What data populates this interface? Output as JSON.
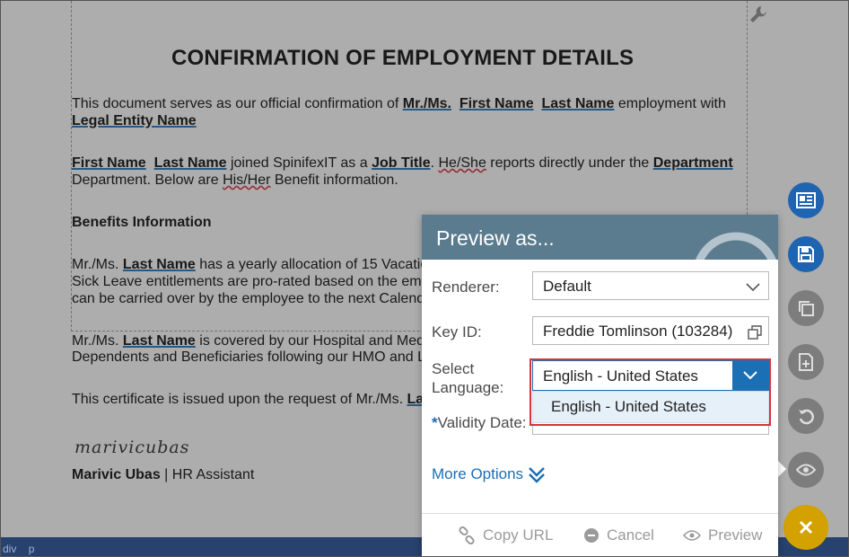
{
  "document": {
    "title": "CONFIRMATION OF EMPLOYMENT DETAILS",
    "p1_pre": "This document serves as our official confirmation of ",
    "p1_field_salutation": "Mr./Ms.",
    "p1_field_first": "First Name",
    "p1_field_last": "Last Name",
    "p1_post": " employment with",
    "p1_field_entity": "Legal Entity Name",
    "p2_field_first": "First Name",
    "p2_field_last": "Last Name",
    "p2_mid": " joined SpinifexIT as a ",
    "p2_field_job": "Job Title",
    "p2_mid2": ". ",
    "p2_heshe": "He/She",
    "p2_mid3": " reports directly under the ",
    "p2_field_dept": "Department",
    "p2_line2_pre": " Department. Below are ",
    "p2_hisher": "His/Her",
    "p2_line2_post": " Benefit information.",
    "benefits_heading": "Benefits Information",
    "p3_pre": "Mr./Ms. ",
    "p3_field_last": "Last Name",
    "p3_post": " has a yearly allocation of 15 Vacatio",
    "p3_line2": "Sick Leave entitlements are pro-rated based on the emp",
    "p3_line3": "can be carried over by the employee to the next Calend",
    "p4_pre": "Mr./Ms. ",
    "p4_field_last": "Last Name",
    "p4_post": "  is covered by our Hospital and Med",
    "p4_line2": "Dependents and Beneficiaries following our HMO and L",
    "p5_pre": "This certificate is issued upon the request of Mr./Ms. ",
    "p5_field": "La",
    "signature": "marivicubas",
    "signer_name": "Marivic Ubas",
    "signer_sep": " | ",
    "signer_role": "HR Assistant"
  },
  "status_bar": {
    "path_1": "div",
    "path_2": "p"
  },
  "dialog": {
    "title": "Preview as...",
    "renderer_label": "Renderer:",
    "renderer_value": "Default",
    "key_id_label": "Key ID:",
    "key_id_value": "Freddie Tomlinson (103284)",
    "language_label_1": "Select",
    "language_label_2": "Language:",
    "language_value": "English - United States",
    "language_options": [
      "English - United States"
    ],
    "validity_label": "Validity Date:",
    "more_options": "More Options",
    "copy_url": "Copy URL",
    "cancel": "Cancel",
    "preview": "Preview"
  },
  "side_toolbar": {
    "icons": [
      "document-view-icon",
      "save-icon",
      "copy-icon",
      "add-document-icon",
      "undo-icon",
      "preview-eye-icon",
      "close-icon"
    ]
  },
  "colors": {
    "accent": "#1b6fb5",
    "dialog_header": "#5b7b8e",
    "highlight": "#d7333b",
    "fab_close": "#d3a100",
    "status_bar": "#27426e"
  }
}
